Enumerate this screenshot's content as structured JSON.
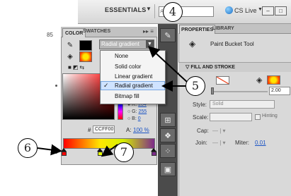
{
  "topbar": {
    "workspace_label": "ESSENTIALS",
    "workspace_arrow": "▼",
    "search_icon": "search-icon",
    "cs_live_label": "CS Live",
    "cs_live_arrow": "▼"
  },
  "stage": {
    "zoom_text": "85"
  },
  "color_panel": {
    "tabs": [
      "COLOR",
      "SWATCHES"
    ],
    "menu_glyph": "▸▸ ≡",
    "type_value": "Radial gradient",
    "dropdown_arrow": "▼",
    "rgb": [
      {
        "label": "● R:",
        "value": "204"
      },
      {
        "label": "○ G:",
        "value": "255"
      },
      {
        "label": "○ B:",
        "value": "0"
      }
    ],
    "hex_prefix": "#",
    "hex_value": "CCFF00",
    "alpha_label": "A:",
    "alpha_value": "100 %"
  },
  "type_menu": {
    "items": [
      "None",
      "Solid color",
      "Linear gradient",
      "Radial gradient",
      "Bitmap fill"
    ],
    "selected": "Radial gradient",
    "check": "✓"
  },
  "properties": {
    "tabs": [
      "PROPERTIES",
      "LIBRARY"
    ],
    "tool_name": "Paint Bucket Tool",
    "section_title": "▽ FILL AND STROKE",
    "stroke_size": "2.00",
    "style_label": "Style:",
    "style_value": "Solid",
    "scale_label": "Scale:",
    "hinting_label": "Hinting",
    "cap_label": "Cap:",
    "join_label": "Join:",
    "miter_label": "Miter:",
    "miter_value": "0.01",
    "dash_glyph": "— | ▾"
  },
  "callouts": [
    "4",
    "5",
    "6",
    "7"
  ],
  "colors": {
    "accent_link": "#1a53c4",
    "panel_bg": "#d9d9d9",
    "dock_bg": "#4b4b4b"
  }
}
